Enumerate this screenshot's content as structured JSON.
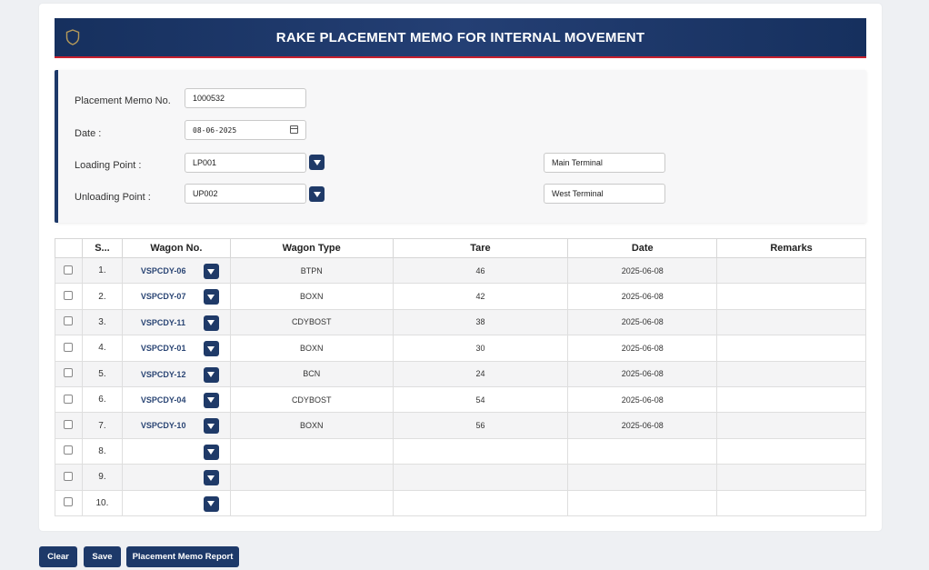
{
  "header": {
    "title": "RAKE PLACEMENT MEMO FOR INTERNAL MOVEMENT"
  },
  "form": {
    "memo_label": "Placement Memo No.",
    "memo_value": "1000532",
    "date_label": "Date :",
    "date_value": "08-06-2025",
    "loading_label": "Loading Point :",
    "loading_value": "LP001",
    "loading_name": "Main Terminal",
    "unloading_label": "Unloading Point :",
    "unloading_value": "UP002",
    "unloading_name": "West Terminal"
  },
  "table": {
    "headers": [
      "",
      "S...",
      "Wagon No.",
      "Wagon Type",
      "Tare",
      "Date",
      "Remarks"
    ],
    "rows": [
      {
        "sno": "1.",
        "wagon": "VSPCDY-06",
        "type": "BTPN",
        "tare": "46",
        "date": "2025-06-08",
        "remarks": ""
      },
      {
        "sno": "2.",
        "wagon": "VSPCDY-07",
        "type": "BOXN",
        "tare": "42",
        "date": "2025-06-08",
        "remarks": ""
      },
      {
        "sno": "3.",
        "wagon": "VSPCDY-11",
        "type": "CDYBOST",
        "tare": "38",
        "date": "2025-06-08",
        "remarks": ""
      },
      {
        "sno": "4.",
        "wagon": "VSPCDY-01",
        "type": "BOXN",
        "tare": "30",
        "date": "2025-06-08",
        "remarks": ""
      },
      {
        "sno": "5.",
        "wagon": "VSPCDY-12",
        "type": "BCN",
        "tare": "24",
        "date": "2025-06-08",
        "remarks": ""
      },
      {
        "sno": "6.",
        "wagon": "VSPCDY-04",
        "type": "CDYBOST",
        "tare": "54",
        "date": "2025-06-08",
        "remarks": ""
      },
      {
        "sno": "7.",
        "wagon": "VSPCDY-10",
        "type": "BOXN",
        "tare": "56",
        "date": "2025-06-08",
        "remarks": ""
      },
      {
        "sno": "8.",
        "wagon": "",
        "type": "",
        "tare": "",
        "date": "",
        "remarks": ""
      },
      {
        "sno": "9.",
        "wagon": "",
        "type": "",
        "tare": "",
        "date": "",
        "remarks": ""
      },
      {
        "sno": "10.",
        "wagon": "",
        "type": "",
        "tare": "",
        "date": "",
        "remarks": ""
      }
    ]
  },
  "buttons": {
    "clear": "Clear",
    "save": "Save",
    "report": "Placement Memo Report"
  },
  "colors": {
    "primary": "#1d3969",
    "accent_red": "#c8202e",
    "header_gradient": "#16305e"
  },
  "icons": {
    "header": "shield-icon",
    "date": "calendar-icon",
    "dropdown": "chevron-down-icon"
  }
}
